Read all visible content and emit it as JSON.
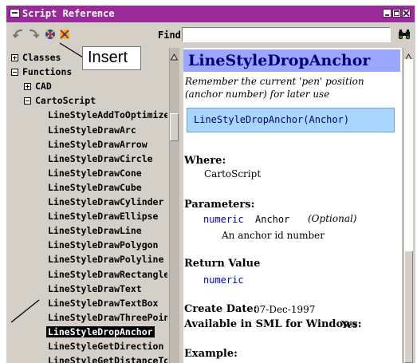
{
  "window": {
    "title": "Script Reference"
  },
  "toolbar": {
    "find_label": "Find",
    "find_value": ""
  },
  "callout": {
    "text": "Insert"
  },
  "tree": {
    "items": [
      {
        "label": "Classes",
        "expander": "plus",
        "indent": 0
      },
      {
        "label": "Functions",
        "expander": "minus",
        "indent": 0
      },
      {
        "label": "CAD",
        "expander": "plus",
        "indent": 1
      },
      {
        "label": "CartoScript",
        "expander": "minus",
        "indent": 1
      },
      {
        "label": "LineStyleAddToOptimize",
        "expander": "",
        "indent": 2
      },
      {
        "label": "LineStyleDrawArc",
        "expander": "",
        "indent": 2
      },
      {
        "label": "LineStyleDrawArrow",
        "expander": "",
        "indent": 2
      },
      {
        "label": "LineStyleDrawCircle",
        "expander": "",
        "indent": 2
      },
      {
        "label": "LineStyleDrawCone",
        "expander": "",
        "indent": 2
      },
      {
        "label": "LineStyleDrawCube",
        "expander": "",
        "indent": 2
      },
      {
        "label": "LineStyleDrawCylinder",
        "expander": "",
        "indent": 2
      },
      {
        "label": "LineStyleDrawEllipse",
        "expander": "",
        "indent": 2
      },
      {
        "label": "LineStyleDrawLine",
        "expander": "",
        "indent": 2
      },
      {
        "label": "LineStyleDrawPolygon",
        "expander": "",
        "indent": 2
      },
      {
        "label": "LineStyleDrawPolyline",
        "expander": "",
        "indent": 2
      },
      {
        "label": "LineStyleDrawRectangle",
        "expander": "",
        "indent": 2
      },
      {
        "label": "LineStyleDrawText",
        "expander": "",
        "indent": 2
      },
      {
        "label": "LineStyleDrawTextBox",
        "expander": "",
        "indent": 2
      },
      {
        "label": "LineStyleDrawThreePoint",
        "expander": "",
        "indent": 2
      },
      {
        "label": "LineStyleDropAnchor",
        "expander": "",
        "indent": 2,
        "selected": true
      },
      {
        "label": "LineStyleGetDirection",
        "expander": "",
        "indent": 2
      },
      {
        "label": "LineStyleGetDistanceTo",
        "expander": "",
        "indent": 2
      }
    ]
  },
  "doc": {
    "title": "LineStyleDropAnchor",
    "description": "Remember the current 'pen' position (anchor number) for later use",
    "syntax": "LineStyleDropAnchor(Anchor)",
    "where_label": "Where:",
    "where_value": "CartoScript",
    "parameters_label": "Parameters:",
    "param_type": "numeric",
    "param_name": "Anchor",
    "param_optional": "(Optional)",
    "param_desc": "An anchor id number",
    "return_label": "Return Value",
    "return_type": "numeric",
    "create_date_label": "Create Date:",
    "create_date_value": "07-Dec-1997",
    "available_label": "Available in SML for Windows:",
    "available_value": "Yes",
    "example_label": "Example:"
  },
  "colors": {
    "titlebar": "#9a2a9a",
    "doc_header": "#9aa6ff",
    "syntax_box": "#a9d6ff",
    "selection": "#000000"
  }
}
